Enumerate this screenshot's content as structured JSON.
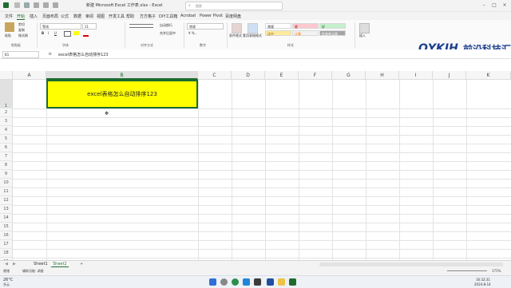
{
  "window": {
    "title": "新建 Microsoft Excel 工作表.xlsx - Excel",
    "search_placeholder": "搜索"
  },
  "menu_tabs": [
    "文件",
    "开始",
    "插入",
    "页面布局",
    "公式",
    "数据",
    "审阅",
    "视图",
    "开发工具",
    "帮助",
    "方方格子",
    "DIY工具箱",
    "Acrobat",
    "Power Pivot",
    "百度网盘"
  ],
  "active_tab": "开始",
  "ribbon": {
    "clipboard": {
      "paste": "粘贴",
      "cut": "剪切",
      "copy": "复制",
      "format_painter": "格式刷",
      "label": "剪贴板"
    },
    "font": {
      "name": "等线",
      "size": "11",
      "bold": "B",
      "italic": "I",
      "underline": "U",
      "label": "字体"
    },
    "alignment": {
      "wrap": "自动换行",
      "merge": "合并后居中",
      "label": "对齐方式"
    },
    "number": {
      "format": "常规",
      "label": "数字"
    },
    "conditional_format": "条件格式",
    "table_format": "套用表格格式",
    "styles": {
      "normal": "常规",
      "bad": "差",
      "good": "好",
      "neutral": "适中",
      "calc": "计算",
      "check": "检查单元格",
      "label": "样式"
    },
    "insert": "插入",
    "logo_text": "前沿科技汇",
    "logo_brand": "QYKJH"
  },
  "formula_bar": {
    "name_box": "B1",
    "fx": "fx",
    "content": "excel表格怎么自动排序123"
  },
  "grid": {
    "columns": [
      "A",
      "B",
      "C",
      "D",
      "E",
      "F",
      "G",
      "H",
      "I",
      "J",
      "K"
    ],
    "selected_column": "B",
    "rows": [
      "1",
      "2",
      "3",
      "4",
      "5",
      "6",
      "7",
      "8",
      "9",
      "10",
      "11",
      "12",
      "13",
      "14",
      "15",
      "16",
      "17",
      "18",
      "19"
    ],
    "selected_row": "1",
    "cell_B1": "excel表格怎么自动排序123",
    "cell_B1_fill": "#ffff00"
  },
  "sheets": [
    "Sheet1",
    "Sheet2"
  ],
  "active_sheet": "Sheet2",
  "add_sheet": "+",
  "status": {
    "ready": "就绪",
    "accessibility": "辅助功能: 调查",
    "zoom": "175%"
  },
  "taskbar": {
    "weather_temp": "26°C",
    "weather_text": "多云",
    "time": "16:32:31",
    "date": "2024-8-14"
  },
  "colors": {
    "accent": "#1e6b2f",
    "selection_fill": "#ffff00"
  }
}
